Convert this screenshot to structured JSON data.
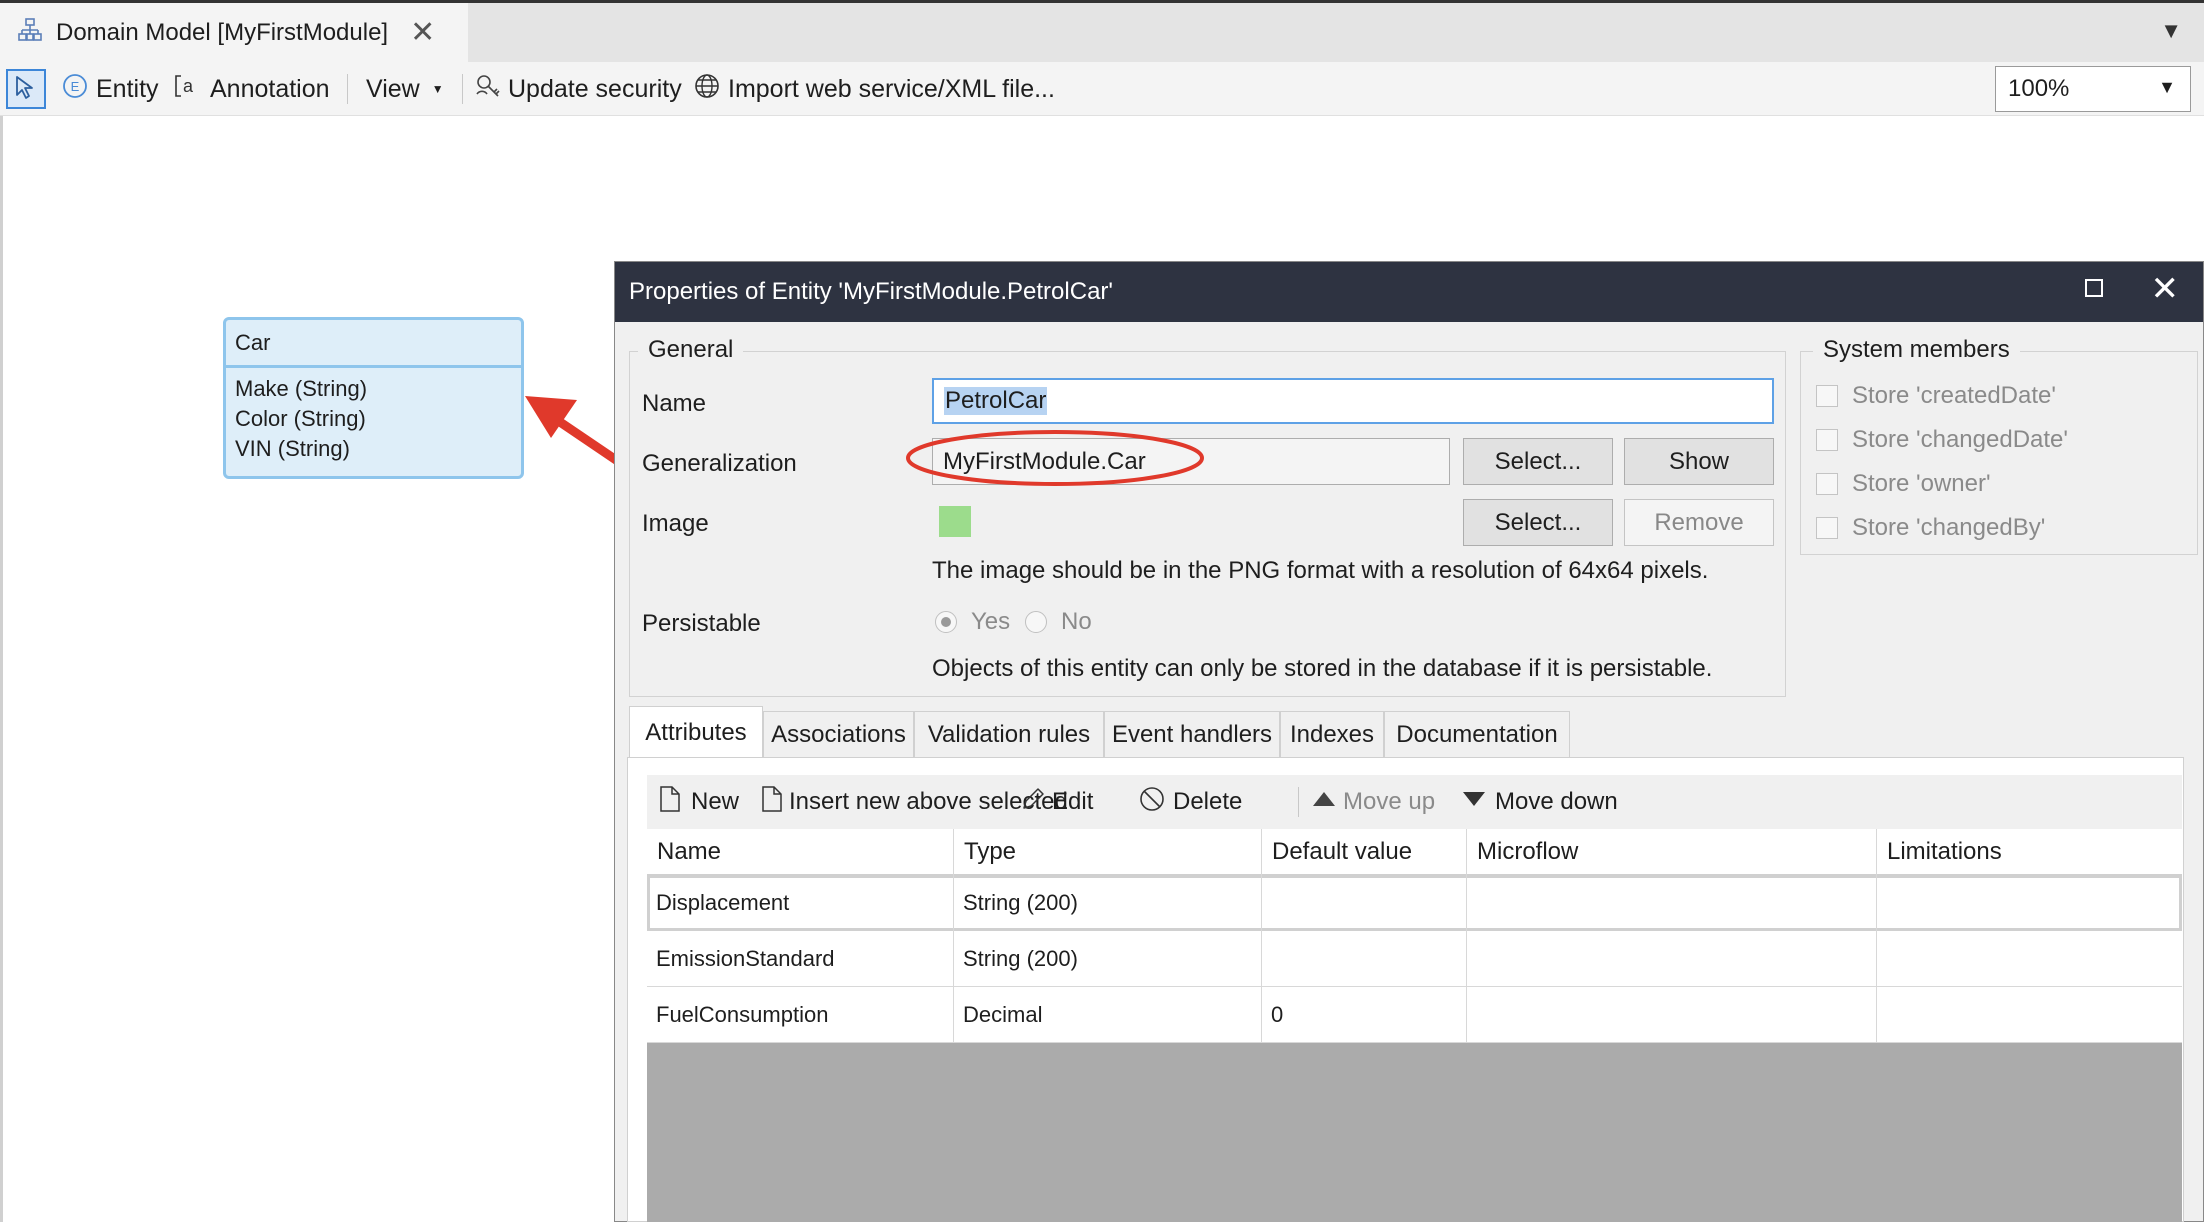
{
  "document_tab": {
    "title": "Domain Model [MyFirstModule]",
    "close_glyph": "✕",
    "icon": "domain-model-icon"
  },
  "toolbar": {
    "entity_label": "Entity",
    "annotation_label": "Annotation",
    "view_label": "View",
    "update_security_label": "Update security",
    "import_label": "Import web service/XML file...",
    "zoom_value": "100%"
  },
  "entity_car": {
    "name": "Car",
    "attributes": [
      "Make (String)",
      "Color (String)",
      "VIN (String)"
    ]
  },
  "dialog": {
    "title": "Properties of Entity 'MyFirstModule.PetrolCar'",
    "general": {
      "legend": "General",
      "name_label": "Name",
      "name_value": "PetrolCar",
      "generalization_label": "Generalization",
      "generalization_value": "MyFirstModule.Car",
      "select_label": "Select...",
      "show_label": "Show",
      "image_label": "Image",
      "image_select_label": "Select...",
      "remove_label": "Remove",
      "image_hint": "The image should be in the PNG format with a resolution of 64x64 pixels.",
      "persistable_label": "Persistable",
      "yes_label": "Yes",
      "no_label": "No",
      "persistable_hint": "Objects of this entity can only be stored in the database if it is persistable."
    },
    "system_members": {
      "legend": "System members",
      "items": [
        "Store 'createdDate'",
        "Store 'changedDate'",
        "Store 'owner'",
        "Store 'changedBy'"
      ]
    },
    "tabs": [
      "Attributes",
      "Associations",
      "Validation rules",
      "Event handlers",
      "Indexes",
      "Documentation"
    ],
    "attr_toolbar": {
      "new_label": "New",
      "insert_label": "Insert new above selected",
      "edit_label": "Edit",
      "delete_label": "Delete",
      "move_up_label": "Move up",
      "move_down_label": "Move down"
    },
    "grid": {
      "headers": [
        "Name",
        "Type",
        "Default value",
        "Microflow",
        "Limitations"
      ],
      "rows": [
        {
          "name": "Displacement",
          "type": "String (200)",
          "default": "",
          "microflow": "",
          "limitations": ""
        },
        {
          "name": "EmissionStandard",
          "type": "String (200)",
          "default": "",
          "microflow": "",
          "limitations": ""
        },
        {
          "name": "FuelConsumption",
          "type": "Decimal",
          "default": "0",
          "microflow": "",
          "limitations": ""
        }
      ]
    }
  },
  "colors": {
    "titlebar": "#2e3341",
    "entity_fill": "#deeef9",
    "entity_border": "#8ec5ec",
    "annotation_red": "#e0392b",
    "image_swatch": "#9cdc8c",
    "selection": "#b7d3f2"
  }
}
